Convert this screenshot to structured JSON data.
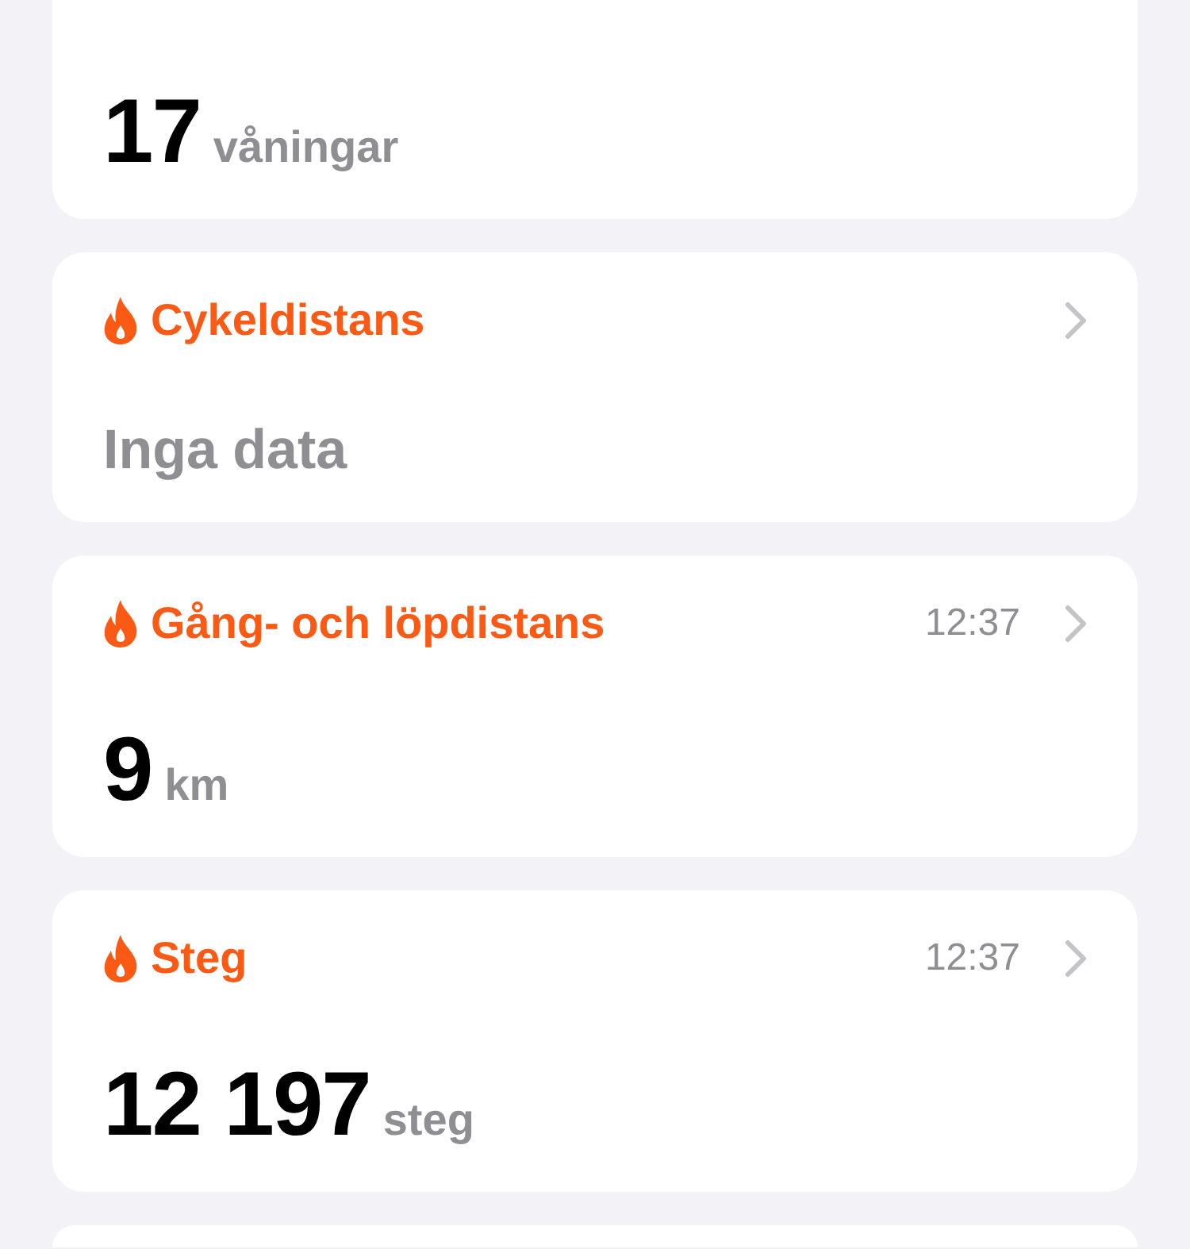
{
  "cards": [
    {
      "kind": "value",
      "value": "17",
      "unit": "våningar"
    },
    {
      "kind": "empty",
      "title": "Cykeldistans",
      "value": "Inga data"
    },
    {
      "kind": "value",
      "title": "Gång- och löpdistans",
      "time": "12:37",
      "value": "9",
      "unit": "km"
    },
    {
      "kind": "value",
      "title": "Steg",
      "time": "12:37",
      "value": "12 197",
      "unit": "steg"
    },
    {
      "kind": "blank"
    }
  ]
}
